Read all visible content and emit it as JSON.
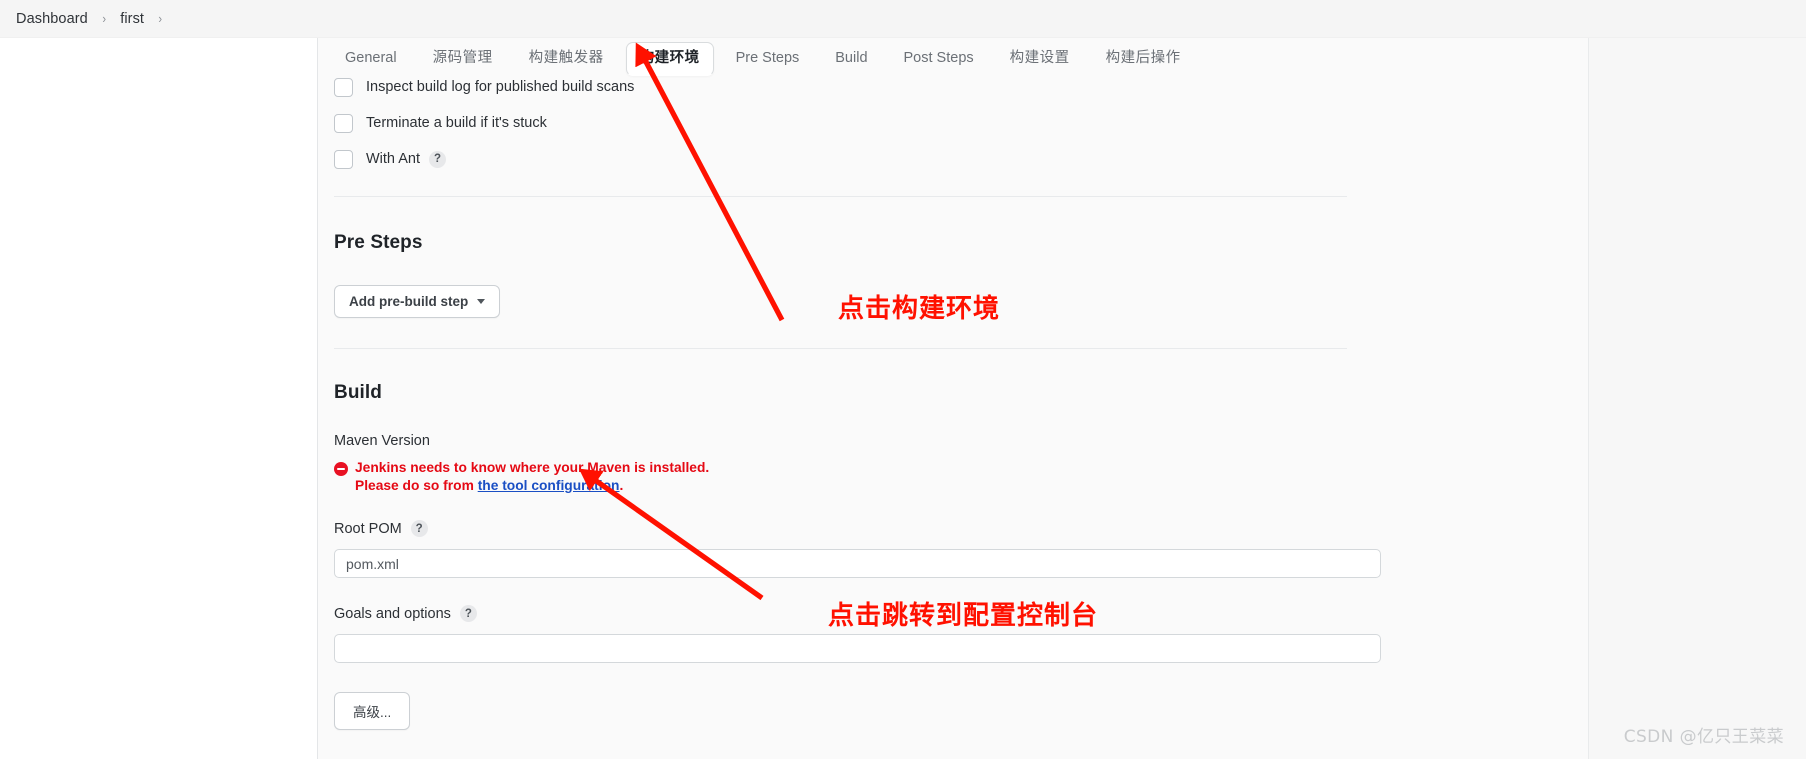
{
  "breadcrumb": {
    "items": [
      {
        "label": "Dashboard"
      },
      {
        "label": "first"
      }
    ],
    "separator": "›"
  },
  "tabs": [
    {
      "label": "General",
      "active": false
    },
    {
      "label": "源码管理",
      "active": false
    },
    {
      "label": "构建触发器",
      "active": false
    },
    {
      "label": "构建环境",
      "active": true
    },
    {
      "label": "Pre Steps",
      "active": false
    },
    {
      "label": "Build",
      "active": false
    },
    {
      "label": "Post Steps",
      "active": false
    },
    {
      "label": "构建设置",
      "active": false
    },
    {
      "label": "构建后操作",
      "active": false
    }
  ],
  "build_environment": {
    "checkboxes": [
      {
        "label": "Inspect build log for published build scans",
        "checked": false,
        "help": false
      },
      {
        "label": "Terminate a build if it's stuck",
        "checked": false,
        "help": false
      },
      {
        "label": "With Ant",
        "checked": false,
        "help": true
      }
    ]
  },
  "pre_steps": {
    "title": "Pre Steps",
    "add_button_label": "Add pre-build step"
  },
  "build": {
    "title": "Build",
    "maven_version_label": "Maven Version",
    "error_line1": "Jenkins needs to know where your Maven is installed.",
    "error_line2_prefix": "Please do so from ",
    "error_link": "the tool configuration",
    "error_line2_suffix": ".",
    "root_pom_label": "Root POM",
    "root_pom_value": "pom.xml",
    "root_pom_placeholder": "pom.xml",
    "goals_label": "Goals and options",
    "goals_value": "",
    "goals_placeholder": "",
    "advanced_button_label": "高级...",
    "help_glyph": "?"
  },
  "annotations": [
    {
      "text": "点击构建环境",
      "color": "#ff1100"
    },
    {
      "text": "点击跳转到配置控制台",
      "color": "#ff1100"
    }
  ],
  "watermark": {
    "text": "CSDN @亿只王菜菜"
  },
  "colors": {
    "annotation_red": "#ff1100",
    "error_red": "#e50914",
    "link_blue": "#1a4fc4",
    "panel_bg": "#fafafa",
    "breadcrumb_bg": "#f5f5f5"
  }
}
